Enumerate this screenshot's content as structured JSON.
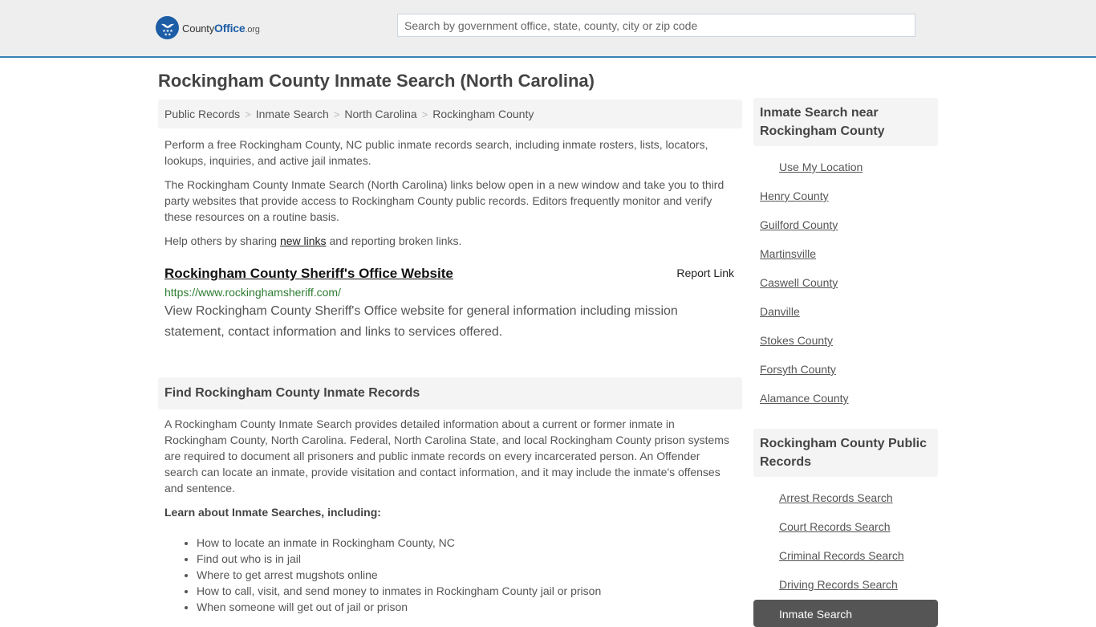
{
  "header": {
    "logo": {
      "name_part1": "County",
      "name_part2": "Office",
      "name_part3": ".org"
    },
    "search_placeholder": "Search by government office, state, county, city or zip code"
  },
  "page_title": "Rockingham County Inmate Search (North Carolina)",
  "breadcrumb": [
    "Public Records",
    "Inmate Search",
    "North Carolina",
    "Rockingham County"
  ],
  "intro": {
    "p1": "Perform a free Rockingham County, NC public inmate records search, including inmate rosters, lists, locators, lookups, inquiries, and active jail inmates.",
    "p2": "The Rockingham County Inmate Search (North Carolina) links below open in a new window and take you to third party websites that provide access to Rockingham County public records. Editors frequently monitor and verify these resources on a routine basis.",
    "p3_before": "Help others by sharing ",
    "p3_link": "new links",
    "p3_after": " and reporting broken links."
  },
  "result": {
    "title": "Rockingham County Sheriff's Office Website",
    "report_label": "Report Link",
    "url": "https://www.rockinghamsheriff.com/",
    "description": "View Rockingham County Sheriff's Office website for general information including mission statement, contact information and links to services offered."
  },
  "find_section": {
    "heading": "Find Rockingham County Inmate Records",
    "paragraph": "A Rockingham County Inmate Search provides detailed information about a current or former inmate in Rockingham County, North Carolina. Federal, North Carolina State, and local Rockingham County prison systems are required to document all prisoners and public inmate records on every incarcerated person. An Offender search can locate an inmate, provide visitation and contact information, and it may include the inmate's offenses and sentence.",
    "learn_heading": "Learn about Inmate Searches, including:",
    "bullets": [
      "How to locate an inmate in Rockingham County, NC",
      "Find out who is in jail",
      "Where to get arrest mugshots online",
      "How to call, visit, and send money to inmates in Rockingham County jail or prison",
      "When someone will get out of jail or prison"
    ]
  },
  "sidebar": {
    "near_heading": "Inmate Search near Rockingham County",
    "use_location": "Use My Location",
    "near_links": [
      "Henry County",
      "Guilford County",
      "Martinsville",
      "Caswell County",
      "Danville",
      "Stokes County",
      "Forsyth County",
      "Alamance County"
    ],
    "records_heading": "Rockingham County Public Records",
    "records_links": [
      "Arrest Records Search",
      "Court Records Search",
      "Criminal Records Search",
      "Driving Records Search"
    ],
    "active_item": "Inmate Search"
  },
  "colors": {
    "header_bg": "#eeeeee",
    "header_border": "#3a7fb5",
    "brand_blue": "#1c5da6",
    "url_green": "#2e7d32",
    "active_bg": "#555555"
  }
}
